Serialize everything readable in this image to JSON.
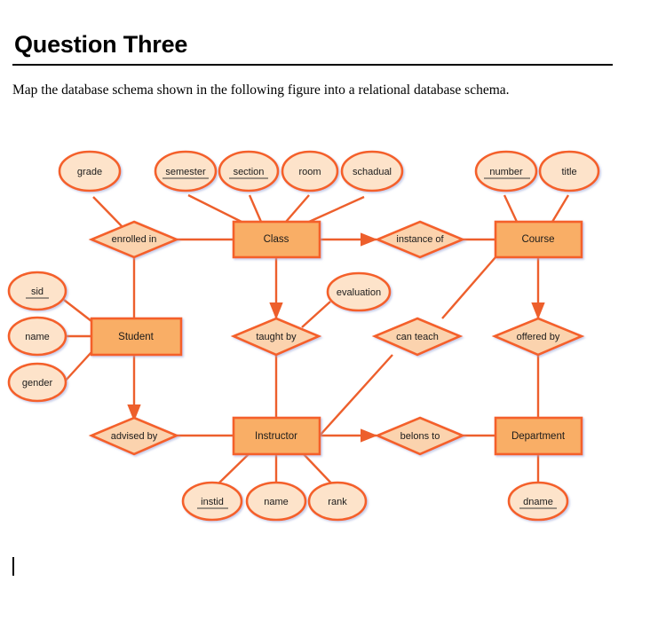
{
  "document": {
    "title": "Question Three",
    "body": "Map the database schema shown in the following figure into a relational database schema."
  },
  "colors": {
    "entity_fill": "#F9AE66",
    "relationship_fill": "#FBD3AE",
    "attribute_fill": "#FDE3CA",
    "stroke": "#F4602B",
    "connector": "#ED5F2C",
    "text": "#1a1a1a"
  },
  "diagram": {
    "type": "er-diagram",
    "entities": [
      {
        "id": "class",
        "label": "Class"
      },
      {
        "id": "course",
        "label": "Course"
      },
      {
        "id": "student",
        "label": "Student"
      },
      {
        "id": "instructor",
        "label": "Instructor"
      },
      {
        "id": "department",
        "label": "Department"
      }
    ],
    "relationships": [
      {
        "id": "enrolled_in",
        "label": "enrolled in"
      },
      {
        "id": "instance_of",
        "label": "instance of"
      },
      {
        "id": "taught_by",
        "label": "taught by"
      },
      {
        "id": "can_teach",
        "label": "can teach"
      },
      {
        "id": "offered_by",
        "label": "offered by"
      },
      {
        "id": "advised_by",
        "label": "advised by"
      },
      {
        "id": "belons_to",
        "label": "belons to"
      }
    ],
    "attributes": [
      {
        "id": "grade",
        "label": "grade",
        "key": false,
        "owner": "enrolled in"
      },
      {
        "id": "semester",
        "label": "semester",
        "key": true,
        "owner": "Class"
      },
      {
        "id": "section",
        "label": "section",
        "key": true,
        "owner": "Class"
      },
      {
        "id": "room",
        "label": "room",
        "key": false,
        "owner": "Class"
      },
      {
        "id": "schadual",
        "label": "schadual",
        "key": false,
        "owner": "Class"
      },
      {
        "id": "number",
        "label": "number",
        "key": true,
        "owner": "Course"
      },
      {
        "id": "title",
        "label": "title",
        "key": false,
        "owner": "Course"
      },
      {
        "id": "sid",
        "label": "sid",
        "key": true,
        "owner": "Student"
      },
      {
        "id": "s_name",
        "label": "name",
        "key": false,
        "owner": "Student"
      },
      {
        "id": "gender",
        "label": "gender",
        "key": false,
        "owner": "Student"
      },
      {
        "id": "evaluation",
        "label": "evaluation",
        "key": false,
        "owner": "taught by"
      },
      {
        "id": "instid",
        "label": "instid",
        "key": true,
        "owner": "Instructor"
      },
      {
        "id": "i_name",
        "label": "name",
        "key": false,
        "owner": "Instructor"
      },
      {
        "id": "rank",
        "label": "rank",
        "key": false,
        "owner": "Instructor"
      },
      {
        "id": "dname",
        "label": "dname",
        "key": true,
        "owner": "Department"
      }
    ]
  }
}
